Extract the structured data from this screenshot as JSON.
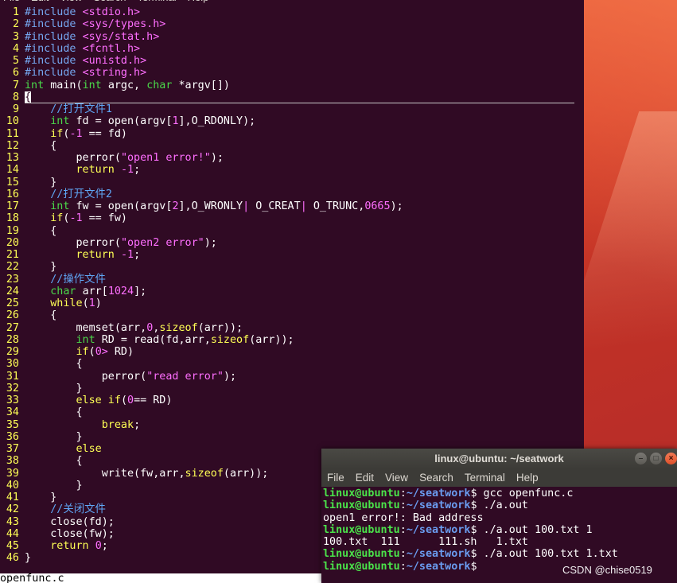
{
  "vim": {
    "menu": [
      "File",
      "Edit",
      "View",
      "Search",
      "Terminal",
      "Help"
    ],
    "status_filename": "openfunc.c",
    "lines": [
      {
        "n": "1",
        "segs": [
          [
            "pp",
            "#include "
          ],
          [
            "str",
            "<stdio.h>"
          ]
        ]
      },
      {
        "n": "2",
        "segs": [
          [
            "pp",
            "#include "
          ],
          [
            "str",
            "<sys/types.h>"
          ]
        ]
      },
      {
        "n": "3",
        "segs": [
          [
            "pp",
            "#include "
          ],
          [
            "str",
            "<sys/stat.h>"
          ]
        ]
      },
      {
        "n": "4",
        "segs": [
          [
            "pp",
            "#include "
          ],
          [
            "str",
            "<fcntl.h>"
          ]
        ]
      },
      {
        "n": "5",
        "segs": [
          [
            "pp",
            "#include "
          ],
          [
            "str",
            "<unistd.h>"
          ]
        ]
      },
      {
        "n": "6",
        "segs": [
          [
            "pp",
            "#include "
          ],
          [
            "str",
            "<string.h>"
          ]
        ]
      },
      {
        "n": "7",
        "segs": [
          [
            "ty",
            "int"
          ],
          [
            "",
            "main("
          ],
          [
            "ty",
            "int"
          ],
          [
            "",
            "argc, "
          ],
          [
            "ty",
            "char"
          ],
          [
            "",
            "*argv[])"
          ]
        ]
      },
      {
        "n": "8",
        "cursor": true,
        "segs": [
          [
            "cursor",
            "{"
          ]
        ]
      },
      {
        "n": "9",
        "segs": [
          [
            "",
            "    "
          ],
          [
            "cm",
            "//打开文件1"
          ]
        ]
      },
      {
        "n": "10",
        "segs": [
          [
            "",
            "    "
          ],
          [
            "ty",
            "int"
          ],
          [
            "",
            "fd = open(argv["
          ],
          [
            "num",
            "1"
          ],
          [
            "",
            "],O_RDONLY);"
          ]
        ]
      },
      {
        "n": "11",
        "segs": [
          [
            "",
            "    "
          ],
          [
            "kw",
            "if"
          ],
          [
            "",
            "("
          ],
          [
            "op",
            "-1"
          ],
          [
            "",
            "== fd)"
          ]
        ]
      },
      {
        "n": "12",
        "segs": [
          [
            "",
            "    {"
          ]
        ]
      },
      {
        "n": "13",
        "segs": [
          [
            "",
            "        perror("
          ],
          [
            "str",
            "\"open1 error!\""
          ],
          [
            "",
            "); "
          ]
        ]
      },
      {
        "n": "14",
        "segs": [
          [
            "",
            "        "
          ],
          [
            "kw",
            "return"
          ],
          [
            "op",
            "-1"
          ],
          [
            "",
            ";"
          ]
        ]
      },
      {
        "n": "15",
        "segs": [
          [
            "",
            "    }"
          ]
        ]
      },
      {
        "n": "16",
        "segs": [
          [
            "",
            "    "
          ],
          [
            "cm",
            "//打开文件2"
          ]
        ]
      },
      {
        "n": "17",
        "segs": [
          [
            "",
            "    "
          ],
          [
            "ty",
            "int"
          ],
          [
            "",
            "fw = open(argv["
          ],
          [
            "num",
            "2"
          ],
          [
            "",
            "],O_WRONLY"
          ],
          [
            "op",
            "|"
          ],
          [
            "",
            "O_CREAT"
          ],
          [
            "op",
            "|"
          ],
          [
            "",
            "O_TRUNC,"
          ],
          [
            "num",
            "0665"
          ],
          [
            "",
            ");"
          ]
        ]
      },
      {
        "n": "18",
        "segs": [
          [
            "",
            "    "
          ],
          [
            "kw",
            "if"
          ],
          [
            "",
            "("
          ],
          [
            "op",
            "-1"
          ],
          [
            "",
            "== fw)"
          ]
        ]
      },
      {
        "n": "19",
        "segs": [
          [
            "",
            "    {"
          ]
        ]
      },
      {
        "n": "20",
        "segs": [
          [
            "",
            "        perror("
          ],
          [
            "str",
            "\"open2 error\""
          ],
          [
            "",
            ");"
          ]
        ]
      },
      {
        "n": "21",
        "segs": [
          [
            "",
            "        "
          ],
          [
            "kw",
            "return"
          ],
          [
            "op",
            "-1"
          ],
          [
            "",
            ";"
          ]
        ]
      },
      {
        "n": "22",
        "segs": [
          [
            "",
            "    }"
          ]
        ]
      },
      {
        "n": "23",
        "segs": [
          [
            "",
            "    "
          ],
          [
            "cm",
            "//操作文件"
          ]
        ]
      },
      {
        "n": "24",
        "segs": [
          [
            "",
            "    "
          ],
          [
            "ty",
            "char"
          ],
          [
            "",
            "arr["
          ],
          [
            "num",
            "1024"
          ],
          [
            "",
            "];"
          ]
        ]
      },
      {
        "n": "25",
        "segs": [
          [
            "",
            "    "
          ],
          [
            "kw",
            "while"
          ],
          [
            "",
            "("
          ],
          [
            "num",
            "1"
          ],
          [
            "",
            ")"
          ]
        ]
      },
      {
        "n": "26",
        "segs": [
          [
            "",
            "    {"
          ]
        ]
      },
      {
        "n": "27",
        "segs": [
          [
            "",
            "        memset(arr,"
          ],
          [
            "num",
            "0"
          ],
          [
            "",
            ","
          ],
          [
            "kw",
            "sizeof"
          ],
          [
            "",
            "(arr));"
          ]
        ]
      },
      {
        "n": "28",
        "segs": [
          [
            "",
            "        "
          ],
          [
            "ty",
            "int"
          ],
          [
            "",
            "RD = read(fd,arr,"
          ],
          [
            "kw",
            "sizeof"
          ],
          [
            "",
            "(arr));"
          ]
        ]
      },
      {
        "n": "29",
        "segs": [
          [
            "",
            "        "
          ],
          [
            "kw",
            "if"
          ],
          [
            "",
            "("
          ],
          [
            "num",
            "0"
          ],
          [
            "op",
            ">"
          ],
          [
            "",
            "RD)"
          ]
        ]
      },
      {
        "n": "30",
        "segs": [
          [
            "",
            "        {"
          ]
        ]
      },
      {
        "n": "31",
        "segs": [
          [
            "",
            "            perror("
          ],
          [
            "str",
            "\"read error\""
          ],
          [
            "",
            ");"
          ]
        ]
      },
      {
        "n": "32",
        "segs": [
          [
            "",
            "        }"
          ]
        ]
      },
      {
        "n": "33",
        "segs": [
          [
            "",
            "        "
          ],
          [
            "kw",
            "else if"
          ],
          [
            "",
            "("
          ],
          [
            "num",
            "0"
          ],
          [
            "",
            "== RD)"
          ]
        ]
      },
      {
        "n": "34",
        "segs": [
          [
            "",
            "        {"
          ]
        ]
      },
      {
        "n": "35",
        "segs": [
          [
            "",
            "            "
          ],
          [
            "kw",
            "break"
          ],
          [
            "",
            ";"
          ]
        ]
      },
      {
        "n": "36",
        "segs": [
          [
            "",
            "        }"
          ]
        ]
      },
      {
        "n": "37",
        "segs": [
          [
            "",
            "        "
          ],
          [
            "kw",
            "else"
          ]
        ]
      },
      {
        "n": "38",
        "segs": [
          [
            "",
            "        {"
          ]
        ]
      },
      {
        "n": "39",
        "segs": [
          [
            "",
            "            write(fw,arr,"
          ],
          [
            "kw",
            "sizeof"
          ],
          [
            "",
            "(arr));"
          ]
        ]
      },
      {
        "n": "40",
        "segs": [
          [
            "",
            "        }"
          ]
        ]
      },
      {
        "n": "41",
        "segs": [
          [
            "",
            "    }"
          ]
        ]
      },
      {
        "n": "42",
        "segs": [
          [
            "",
            "    "
          ],
          [
            "cm",
            "//关闭文件"
          ]
        ]
      },
      {
        "n": "43",
        "segs": [
          [
            "",
            "    close(fd);"
          ]
        ]
      },
      {
        "n": "44",
        "segs": [
          [
            "",
            "    close(fw);"
          ]
        ]
      },
      {
        "n": "45",
        "segs": [
          [
            "",
            "    "
          ],
          [
            "kw",
            "return"
          ],
          [
            "num",
            "0"
          ],
          [
            "",
            ";"
          ]
        ]
      },
      {
        "n": "46",
        "segs": [
          [
            "",
            "}"
          ]
        ]
      }
    ]
  },
  "terminal": {
    "title": "linux@ubuntu: ~/seatwork",
    "buttons": {
      "minimize": "–",
      "maximize": "□",
      "close": "×"
    },
    "menu": [
      "File",
      "Edit",
      "View",
      "Search",
      "Terminal",
      "Help"
    ],
    "lines": [
      {
        "prompt": true,
        "user": "linux@ubuntu",
        "path": "~/seatwork",
        "cmd": " gcc openfunc.c"
      },
      {
        "prompt": true,
        "user": "linux@ubuntu",
        "path": "~/seatwork",
        "cmd": " ./a.out"
      },
      {
        "prompt": false,
        "text": "open1 error!: Bad address"
      },
      {
        "prompt": true,
        "user": "linux@ubuntu",
        "path": "~/seatwork",
        "cmd": " ./a.out 100.txt 1"
      },
      {
        "prompt": false,
        "text": "100.txt  111      111.sh   1.txt"
      },
      {
        "prompt": true,
        "user": "linux@ubuntu",
        "path": "~/seatwork",
        "cmd": " ./a.out 100.txt 1.txt"
      },
      {
        "prompt": true,
        "user": "linux@ubuntu",
        "path": "~/seatwork",
        "cmd": ""
      }
    ]
  },
  "watermark": "CSDN @chise0519"
}
